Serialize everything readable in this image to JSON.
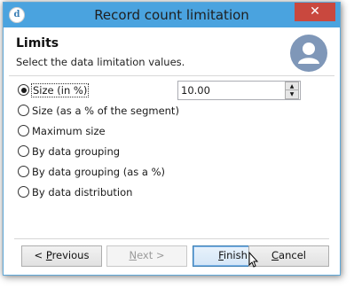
{
  "window": {
    "title": "Record count limitation",
    "close_glyph": "✕",
    "app_icon_letter": "d"
  },
  "header": {
    "title": "Limits",
    "subtitle": "Select the data limitation values."
  },
  "options": [
    {
      "label": "Size (in %)",
      "checked": true
    },
    {
      "label": "Size (as a % of the segment)",
      "checked": false
    },
    {
      "label": "Maximum size",
      "checked": false
    },
    {
      "label": "By data grouping",
      "checked": false
    },
    {
      "label": "By data grouping (as a %)",
      "checked": false
    },
    {
      "label": "By data distribution",
      "checked": false
    }
  ],
  "size_input": {
    "value": "10.00",
    "up_glyph": "▲",
    "down_glyph": "▼"
  },
  "buttons": {
    "previous": "< Previous",
    "next": "Next >",
    "finish": "Finish",
    "cancel": "Cancel"
  },
  "colors": {
    "titlebar": "#4aa3df",
    "close": "#c9483e",
    "avatar": "#7f97b8"
  }
}
